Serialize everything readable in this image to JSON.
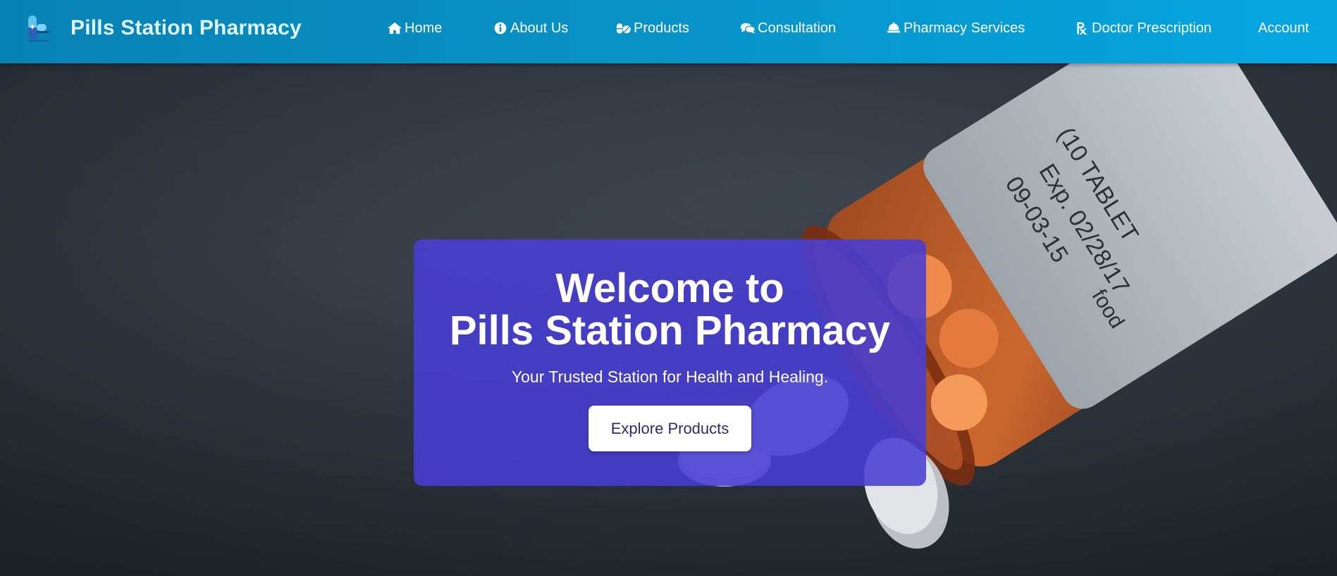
{
  "brand": {
    "name": "Pills Station Pharmacy",
    "logo_icon": "capsule-logo-icon"
  },
  "nav": {
    "items": [
      {
        "label": "Home",
        "icon": "home-icon"
      },
      {
        "label": "About Us",
        "icon": "info-circle-icon"
      },
      {
        "label": "Products",
        "icon": "pills-icon"
      },
      {
        "label": "Consultation",
        "icon": "comments-icon"
      },
      {
        "label": "Pharmacy Services",
        "icon": "bell-icon"
      },
      {
        "label": "Doctor Prescription",
        "icon": "prescription-icon"
      },
      {
        "label": "Account",
        "icon": ""
      }
    ]
  },
  "hero": {
    "title_line1": "Welcome to",
    "title_line2": "Pills Station Pharmacy",
    "subtitle": "Your Trusted Station for Health and Healing.",
    "cta_label": "Explore Products",
    "bottle_label": {
      "line1": "09-03-15",
      "line2": "Exp. 02/28/17",
      "line3": "(10 TABLET",
      "line4": "food"
    }
  },
  "colors": {
    "header_start": "#0882b4",
    "header_end": "#06a6e3",
    "brand_text": "#dff6ff",
    "card_bg": "#483ed4",
    "button_text": "#2c2c6c"
  }
}
